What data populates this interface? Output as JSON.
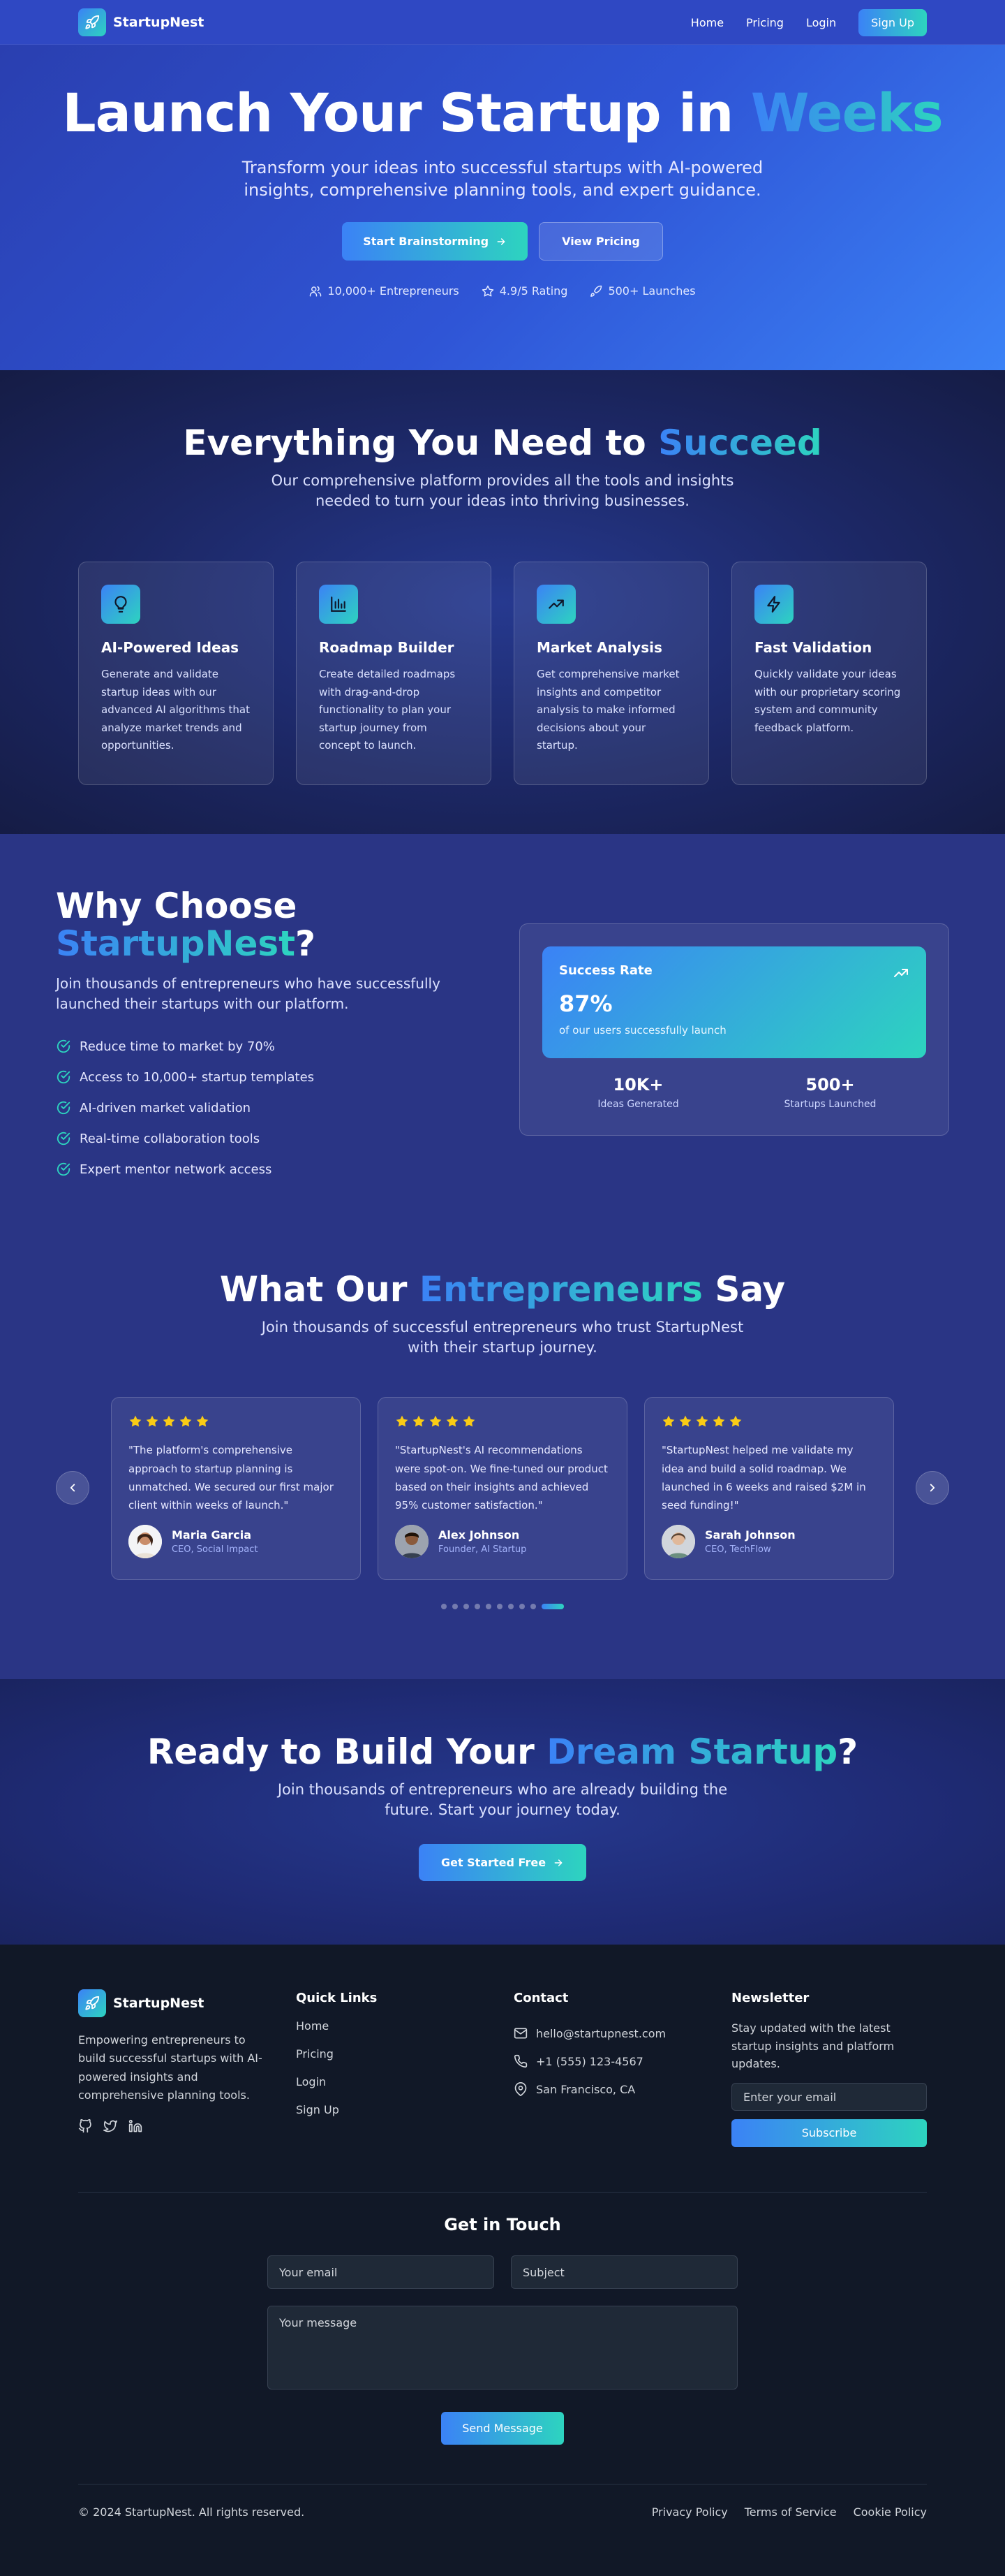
{
  "brand": {
    "name": "StartupNest"
  },
  "nav": {
    "links": [
      "Home",
      "Pricing",
      "Login"
    ],
    "signup": "Sign Up"
  },
  "hero": {
    "title_main": "Launch Your Startup in ",
    "title_accent": "Weeks",
    "subtitle": "Transform your ideas into successful startups with AI-powered insights, comprehensive planning tools, and expert guidance.",
    "primary_btn": "Start Brainstorming",
    "secondary_btn": "View Pricing",
    "stats": [
      "10,000+ Entrepreneurs",
      "4.9/5 Rating",
      "500+ Launches"
    ]
  },
  "features": {
    "title_main": "Everything You Need to ",
    "title_accent": "Succeed",
    "subtitle": "Our comprehensive platform provides all the tools and insights needed to turn your ideas into thriving businesses.",
    "cards": [
      {
        "icon": "lightbulb-icon",
        "title": "AI-Powered Ideas",
        "text": "Generate and validate startup ideas with our advanced AI algorithms that analyze market trends and opportunities."
      },
      {
        "icon": "bar-chart-icon",
        "title": "Roadmap Builder",
        "text": "Create detailed roadmaps with drag-and-drop functionality to plan your startup journey from concept to launch."
      },
      {
        "icon": "trending-up-icon",
        "title": "Market Analysis",
        "text": "Get comprehensive market insights and competitor analysis to make informed decisions about your startup."
      },
      {
        "icon": "lightning-icon",
        "title": "Fast Validation",
        "text": "Quickly validate your ideas with our proprietary scoring system and community feedback platform."
      }
    ]
  },
  "why": {
    "title_main": "Why Choose",
    "title_accent": "StartupNest",
    "title_end": "?",
    "lead": "Join thousands of entrepreneurs who have successfully launched their startups with our platform.",
    "items": [
      "Reduce time to market by 70%",
      "Access to 10,000+ startup templates",
      "AI-driven market validation",
      "Real-time collaboration tools",
      "Expert mentor network access"
    ],
    "success": {
      "label": "Success Rate",
      "value": "87%",
      "caption": "of our users successfully launch"
    },
    "stats": [
      {
        "value": "10K+",
        "label": "Ideas Generated"
      },
      {
        "value": "500+",
        "label": "Startups Launched"
      }
    ]
  },
  "testimonials": {
    "title_main": "What Our ",
    "title_accent": "Entrepreneurs",
    "title_end": " Say",
    "subtitle": "Join thousands of successful entrepreneurs who trust StartupNest with their startup journey.",
    "rating": 5,
    "items": [
      {
        "quote": "\"The platform's comprehensive approach to startup planning is unmatched. We secured our first major client within weeks of launch.\"",
        "name": "Maria Garcia",
        "role": "CEO, Social Impact"
      },
      {
        "quote": "\"StartupNest's AI recommendations were spot-on. We fine-tuned our product based on their insights and achieved 95% customer satisfaction.\"",
        "name": "Alex Johnson",
        "role": "Founder, AI Startup"
      },
      {
        "quote": "\"StartupNest helped me validate my idea and build a solid roadmap. We launched in 6 weeks and raised $2M in seed funding!\"",
        "name": "Sarah Johnson",
        "role": "CEO, TechFlow"
      }
    ],
    "dots": 10,
    "active_dot": 9
  },
  "cta": {
    "title_main": "Ready to Build Your ",
    "title_accent": "Dream Startup",
    "title_end": "?",
    "subtitle": "Join thousands of entrepreneurs who are already building the future. Start your journey today.",
    "button": "Get Started Free"
  },
  "footer": {
    "description": "Empowering entrepreneurs to build successful startups with AI-powered insights and comprehensive planning tools.",
    "quick_links_title": "Quick Links",
    "quick_links": [
      "Home",
      "Pricing",
      "Login",
      "Sign Up"
    ],
    "contact_title": "Contact",
    "contact": {
      "email": "hello@startupnest.com",
      "phone": "+1 (555) 123-4567",
      "location": "San Francisco, CA"
    },
    "newsletter_title": "Newsletter",
    "newsletter_text": "Stay updated with the latest startup insights and platform updates.",
    "newsletter_placeholder": "Enter your email",
    "newsletter_btn": "Subscribe",
    "touch_title": "Get in Touch",
    "touch_email_placeholder": "Your email",
    "touch_subject_placeholder": "Subject",
    "touch_message_placeholder": "Your message",
    "touch_btn": "Send Message",
    "copyright": "© 2024 StartupNest. All rights reserved.",
    "legal": [
      "Privacy Policy",
      "Terms of Service",
      "Cookie Policy"
    ]
  },
  "colors": {
    "accent_from": "#3b82f6",
    "accent_to": "#2dd4bf",
    "star": "#facc15"
  }
}
